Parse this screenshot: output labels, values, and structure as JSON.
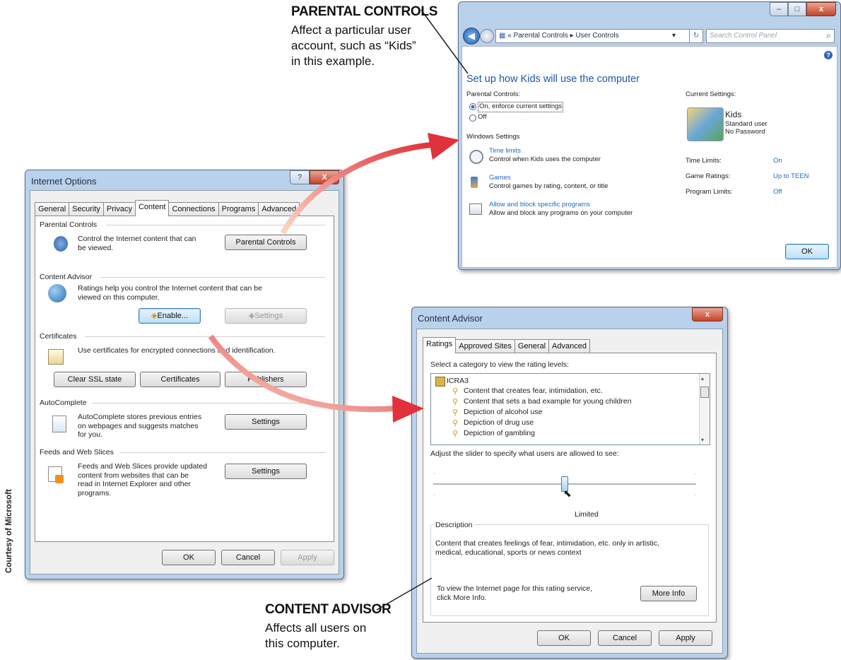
{
  "annotations": {
    "parental": {
      "title": "PARENTAL CONTROLS",
      "lines": [
        "Affect a particular user",
        "account, such as “Kids”",
        "in this example."
      ]
    },
    "content_advisor": {
      "title": "CONTENT ADVISOR",
      "lines": [
        "Affects all users on",
        "this computer."
      ]
    },
    "credit": "Courtesy of Microsoft"
  },
  "internet_options": {
    "title": "Internet Options",
    "caption_buttons": {
      "help": "?",
      "close": "X"
    },
    "tabs": [
      "General",
      "Security",
      "Privacy",
      "Content",
      "Connections",
      "Programs",
      "Advanced"
    ],
    "active_tab": "Content",
    "parental_controls": {
      "header": "Parental Controls",
      "text": [
        "Control the Internet content that can",
        "be viewed."
      ],
      "button": "Parental Controls"
    },
    "content_advisor": {
      "header": "Content Advisor",
      "text": [
        "Ratings help you control the Internet content that can be",
        "viewed on this computer."
      ],
      "enable": "Enable...",
      "settings": "Settings"
    },
    "certificates": {
      "header": "Certificates",
      "text": "Use certificates for encrypted connections and identification.",
      "buttons": [
        "Clear SSL state",
        "Certificates",
        "Publishers"
      ]
    },
    "autocomplete": {
      "header": "AutoComplete",
      "text": [
        "AutoComplete stores previous entries",
        "on webpages and suggests matches",
        "for you."
      ],
      "button": "Settings"
    },
    "feeds": {
      "header": "Feeds and Web Slices",
      "text": [
        "Feeds and Web Slices provide updated",
        "content from websites that can be",
        "read in Internet Explorer and other",
        "programs."
      ],
      "button": "Settings"
    },
    "footer": {
      "ok": "OK",
      "cancel": "Cancel",
      "apply": "Apply"
    }
  },
  "user_controls": {
    "address": {
      "back": "«",
      "crumbs": [
        "Parental Controls",
        "User Controls"
      ],
      "search_placeholder": "Search Control Panel"
    },
    "heading": "Set up how Kids will use the computer",
    "parental_controls_label": "Parental Controls:",
    "radio_on": "On, enforce current settings",
    "radio_off": "Off",
    "radio_selected": "On, enforce current settings",
    "windows_settings_label": "Windows Settings",
    "settings": [
      {
        "link": "Time limits",
        "desc": "Control when Kids uses the computer",
        "icon": "clock-icon"
      },
      {
        "link": "Games",
        "desc": "Control games by rating, content, or title",
        "icon": "games-icon"
      },
      {
        "link": "Allow and block specific programs",
        "desc": "Allow and block any programs on your computer",
        "icon": "programs-icon"
      }
    ],
    "current_settings_label": "Current Settings:",
    "user": {
      "name": "Kids",
      "type": "Standard user",
      "password": "No Password"
    },
    "limits": [
      {
        "label": "Time Limits:",
        "value": "On"
      },
      {
        "label": "Game Ratings:",
        "value": "Up to TEEN"
      },
      {
        "label": "Program Limits:",
        "value": "Off"
      }
    ],
    "ok": "OK"
  },
  "content_advisor_dialog": {
    "title": "Content Advisor",
    "tabs": [
      "Ratings",
      "Approved Sites",
      "General",
      "Advanced"
    ],
    "active_tab": "Ratings",
    "select_label": "Select a category to view the rating levels:",
    "root": "ICRA3",
    "categories": [
      "Content that creates fear, intimidation, etc.",
      "Content that sets a bad example for young children",
      "Depiction of alcohol use",
      "Depiction of drug use",
      "Depiction of gambling"
    ],
    "slider_label": "Adjust the slider to specify what users are allowed to see:",
    "slider_value_label": "Limited",
    "slider_position": 0.5,
    "description_header": "Description",
    "description": [
      "Content that creates feelings of fear, intimidation, etc. only in artistic,",
      "medical, educational, sports or news context"
    ],
    "more_info_text": [
      "To view the Internet page for this rating service,",
      "click More Info."
    ],
    "more_info_button": "More Info",
    "ok": "OK",
    "cancel": "Cancel",
    "apply": "Apply"
  },
  "colors": {
    "arrow": "#e0323a",
    "link": "#1a6cc4",
    "frame": "#b9d1ea"
  }
}
